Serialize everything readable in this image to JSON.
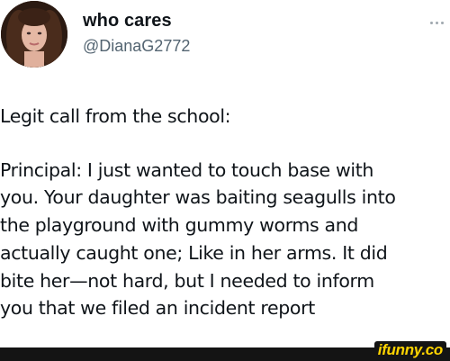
{
  "tweet": {
    "display_name": "who cares",
    "handle": "@DianaG2772",
    "text_lines": [
      "Legit call from the school:",
      "",
      "Principal: I just wanted to touch base with",
      "you.  Your daughter was baiting seagulls into",
      "the playground with gummy worms and",
      "actually caught one; Like in her arms. It did",
      "bite her—not hard, but I needed to inform",
      "you that we filed an incident report"
    ],
    "icons": {
      "avatar": "avatar",
      "more": "more-icon"
    }
  },
  "watermark": {
    "text": "ifunny.co",
    "color": "#ffd400",
    "bar_color": "#141414"
  }
}
